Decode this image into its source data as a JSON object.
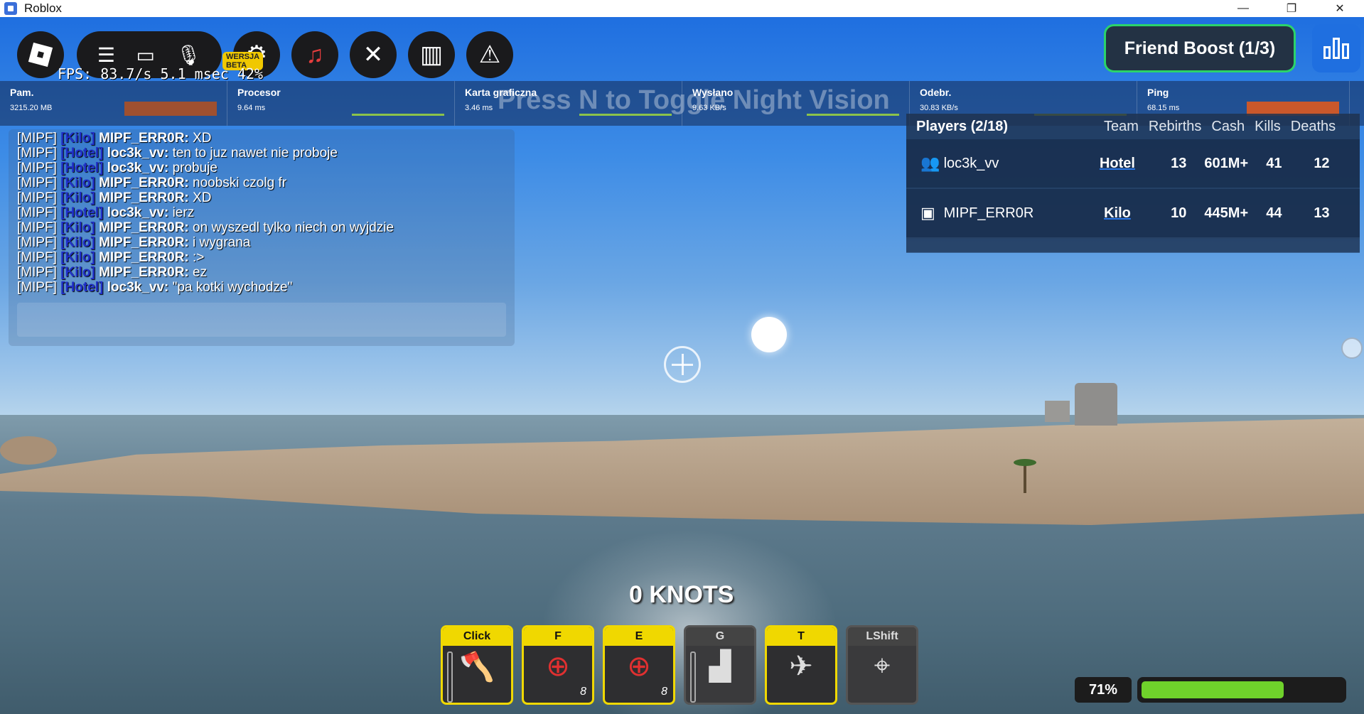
{
  "window": {
    "title": "Roblox",
    "controls": [
      "—",
      "❐",
      "✕"
    ]
  },
  "topbar": {
    "beta_badge": "WERSJA BETA",
    "fps_text": "FPS: 83.7/s 5.1 msec 42%"
  },
  "friend_boost": "Friend Boost (1/3)",
  "stats": [
    {
      "label": "Pam.",
      "value": "3215.20 MB",
      "graph_color": "#b5501f"
    },
    {
      "label": "Procesor",
      "value": "9.64 ms",
      "graph_color": "#8bc34a"
    },
    {
      "label": "Karta graficzna",
      "value": "3.46 ms",
      "graph_color": "#8bc34a"
    },
    {
      "label": "Wysłano",
      "value": "9.63 KB/s",
      "graph_color": "#8bc34a"
    },
    {
      "label": "Odebr.",
      "value": "30.83 KB/s",
      "graph_color": "#c8d400"
    },
    {
      "label": "Ping",
      "value": "68.15 ms",
      "graph_color": "#e85a1a"
    }
  ],
  "night_vision_hint": "Press N to Toggle Night Vision",
  "chat": [
    {
      "prefix": "[MIPF]",
      "team": "[Kilo]",
      "name": "MIPF_ERR0R:",
      "msg": "XD"
    },
    {
      "prefix": "[MIPF]",
      "team": "[Hotel]",
      "name": "loc3k_vv:",
      "msg": "ten to juz nawet nie proboje"
    },
    {
      "prefix": "[MIPF]",
      "team": "[Hotel]",
      "name": "loc3k_vv:",
      "msg": "probuje"
    },
    {
      "prefix": "[MIPF]",
      "team": "[Kilo]",
      "name": "MIPF_ERR0R:",
      "msg": "noobski czolg fr"
    },
    {
      "prefix": "[MIPF]",
      "team": "[Kilo]",
      "name": "MIPF_ERR0R:",
      "msg": "XD"
    },
    {
      "prefix": "[MIPF]",
      "team": "[Hotel]",
      "name": "loc3k_vv:",
      "msg": "ierz"
    },
    {
      "prefix": "[MIPF]",
      "team": "[Kilo]",
      "name": "MIPF_ERR0R:",
      "msg": "on wyszedl tylko niech on wyjdzie"
    },
    {
      "prefix": "[MIPF]",
      "team": "[Kilo]",
      "name": "MIPF_ERR0R:",
      "msg": "i wygrana"
    },
    {
      "prefix": "[MIPF]",
      "team": "[Kilo]",
      "name": "MIPF_ERR0R:",
      "msg": ":>"
    },
    {
      "prefix": "[MIPF]",
      "team": "[Kilo]",
      "name": "MIPF_ERR0R:",
      "msg": "ez"
    },
    {
      "prefix": "[MIPF]",
      "team": "[Hotel]",
      "name": "loc3k_vv:",
      "msg": "\"pa kotki wychodze\""
    }
  ],
  "players": {
    "title": "Players (2/18)",
    "columns": [
      "Team",
      "Rebirths",
      "Cash",
      "Kills",
      "Deaths"
    ],
    "rows": [
      {
        "name": "loc3k_vv",
        "team": "Hotel",
        "rebirths": "13",
        "cash": "601M+",
        "kills": "41",
        "deaths": "12",
        "icon": "friends-icon"
      },
      {
        "name": "MIPF_ERR0R",
        "team": "Kilo",
        "rebirths": "10",
        "cash": "445M+",
        "kills": "44",
        "deaths": "13",
        "icon": "premium-icon"
      }
    ]
  },
  "speed": "0 KNOTS",
  "hotbar": [
    {
      "key": "Click",
      "icon": "axe-icon",
      "count": ""
    },
    {
      "key": "F",
      "icon": "missile-target-icon",
      "count": "8"
    },
    {
      "key": "E",
      "icon": "rocket-target-icon",
      "count": "8"
    },
    {
      "key": "G",
      "icon": "turret-icon",
      "count": ""
    },
    {
      "key": "T",
      "icon": "jet-icon",
      "count": ""
    },
    {
      "key": "LShift",
      "icon": "crosshair-icon",
      "count": ""
    }
  ],
  "health": {
    "percent_label": "71%",
    "fraction": 0.71,
    "color": "#6fd22b"
  }
}
